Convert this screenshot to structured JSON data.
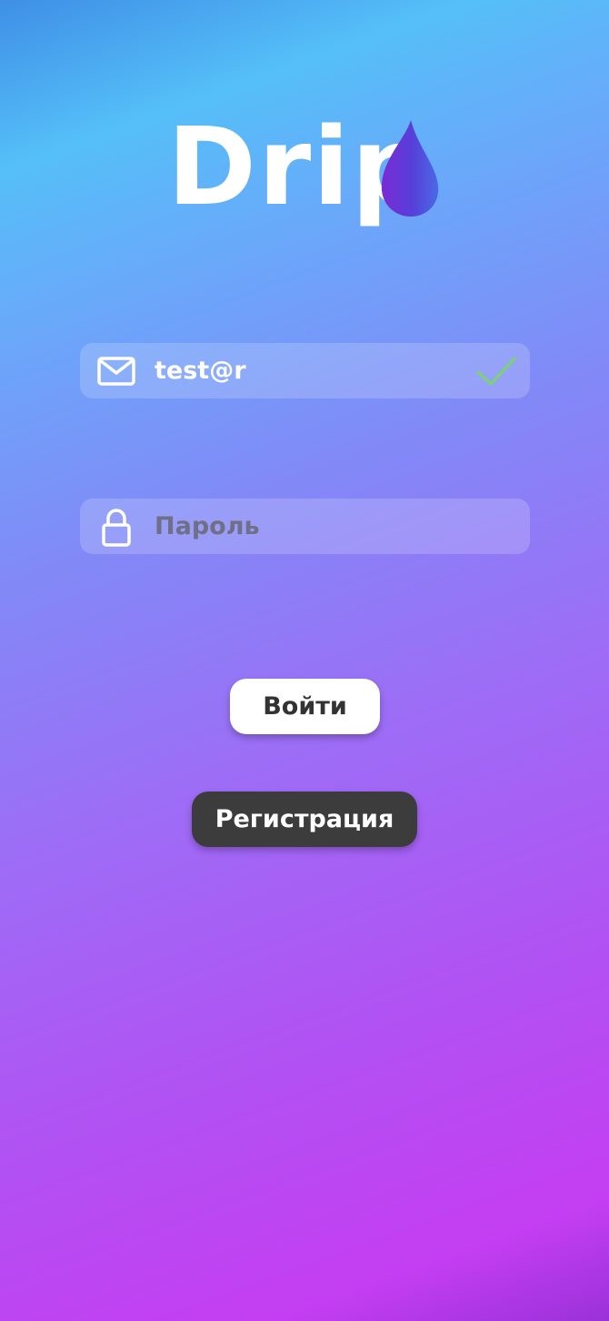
{
  "logo": {
    "text": "Drip"
  },
  "email_field": {
    "value": "test@r",
    "icon": "mail-icon",
    "status_icon": "checkmark-icon"
  },
  "password_field": {
    "placeholder": "Пароль",
    "icon": "lock-icon"
  },
  "buttons": {
    "login_label": "Войти",
    "register_label": "Регистрация"
  },
  "colors": {
    "gradient_top": "#55bff8",
    "gradient_bottom": "#c43ef2",
    "check_green": "#7ccf7c",
    "register_bg": "#3c3c3c",
    "login_bg": "#ffffff"
  }
}
